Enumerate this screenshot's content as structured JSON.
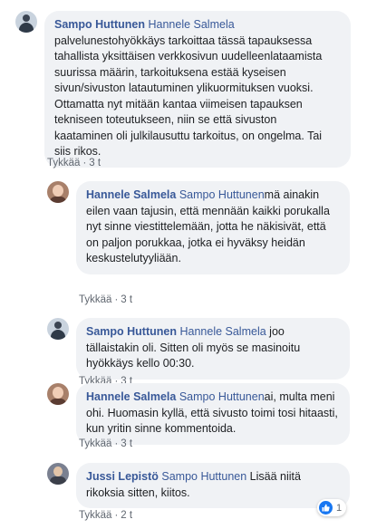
{
  "comments": [
    {
      "author": "Sampo Huttunen",
      "tag": "Hannele Salmela",
      "text_lines": [
        "palvelunestohyökkäys tarkoittaa tässä tapauksessa",
        "tahallista yksittäisen verkkosivun uudelleenlataamista",
        "suurissa määrin, tarkoituksena estää kyseisen",
        "sivun/sivuston latautuminen ylikuormituksen vuoksi.",
        "Ottamatta nyt mitään kantaa viimeisen tapauksen",
        "tekniseen toteutukseen, niin se että sivuston",
        "kaataminen oli julkilausuttu tarkoitus, on ongelma. Tai",
        "siis rikos."
      ],
      "like_label": "Tykkää",
      "time": "3 t"
    },
    {
      "author": "Hannele Salmela",
      "tag": "Sampo Huttunen",
      "first_line_rest": "mä ainakin",
      "text_lines": [
        "eilen vaan tajusin, että mennään kaikki porukalla",
        "nyt sinne viestittelemään, jotta he näkisivät, että",
        "on paljon porukkaa, jotka ei hyväksy heidän",
        "keskustelutyyliään."
      ],
      "like_label": "Tykkää",
      "time": "3 t"
    },
    {
      "author": "Sampo Huttunen",
      "tag": "Hannele Salmela",
      "first_line_rest": " joo",
      "text_lines": [
        "tällaistakin oli. Sitten oli myös se masinoitu",
        "hyökkäys kello 00:30."
      ],
      "like_label": "Tykkää",
      "time": "3 t"
    },
    {
      "author": "Hannele Salmela",
      "tag": "Sampo Huttunen",
      "first_line_rest": "ai, multa meni",
      "text_lines": [
        "ohi. Huomasin kyllä, että sivusto toimi tosi hitaasti,",
        "kun yritin sinne kommentoida."
      ],
      "like_label": "Tykkää",
      "time": "3 t"
    },
    {
      "author": "Jussi Lepistö",
      "tag": "Sampo Huttunen",
      "first_line_rest": " Lisää niitä",
      "text_lines": [
        "rikoksia sitten, kiitos."
      ],
      "like_label": "Tykkää",
      "time": "2 t",
      "reaction_count": "1"
    }
  ],
  "separator": "·",
  "colors": {
    "name_blue": "#385898",
    "bubble_bg": "#f0f2f5",
    "meta_gray": "#606770",
    "like_blue": "#1877f2"
  },
  "icons": {
    "reaction": "thumbs-up-icon"
  }
}
